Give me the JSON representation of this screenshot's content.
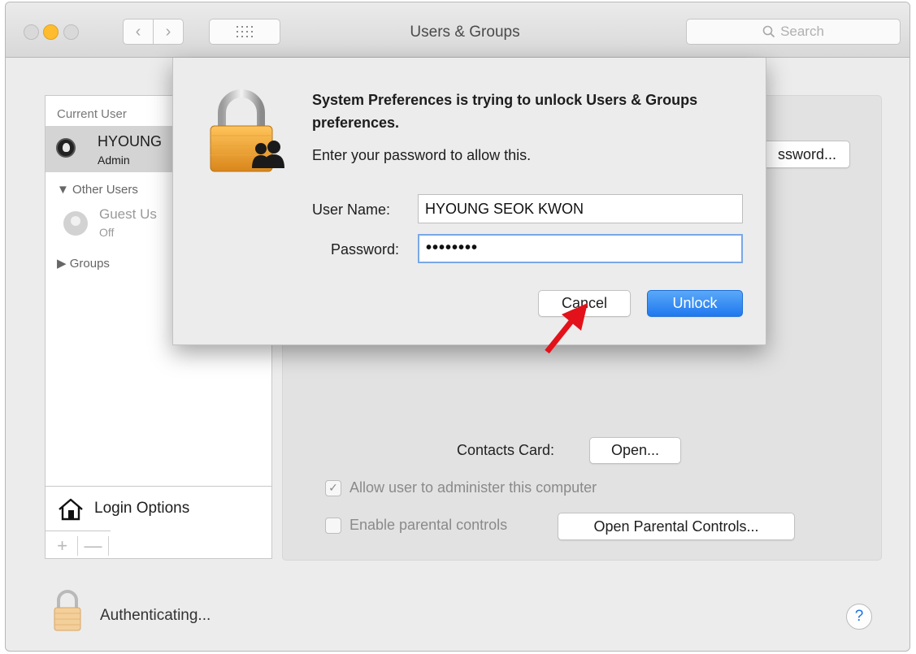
{
  "window": {
    "title": "Users & Groups",
    "search_placeholder": "Search"
  },
  "sidebar": {
    "current_user_header": "Current User",
    "current_user_name": "HYOUNG",
    "current_user_role": "Admin",
    "other_users_header": "Other Users",
    "guest_name": "Guest Us",
    "guest_status": "Off",
    "groups_label": "Groups",
    "login_options_label": "Login Options",
    "add_symbol": "+",
    "remove_symbol": "—"
  },
  "main": {
    "change_password_label": "ssword...",
    "contacts_card_label": "Contacts Card:",
    "contacts_open_label": "Open...",
    "allow_admin_label": "Allow user to administer this computer",
    "allow_admin_checked": true,
    "parental_controls_label": "Enable parental controls",
    "parental_controls_checked": false,
    "open_parental_label": "Open Parental Controls..."
  },
  "auth_dialog": {
    "title": "System Preferences is trying to unlock Users & Groups preferences.",
    "message": "Enter your password to allow this.",
    "username_label": "User Name:",
    "username_value": "HYOUNG SEOK KWON",
    "password_label": "Password:",
    "password_masked": "••••••••",
    "cancel_label": "Cancel",
    "unlock_label": "Unlock"
  },
  "footer": {
    "status_text": "Authenticating...",
    "help_label": "?"
  },
  "colors": {
    "accent_blue": "#1f78ef",
    "annotation_arrow": "#e3111a",
    "lock_gold": "#f0a227"
  }
}
